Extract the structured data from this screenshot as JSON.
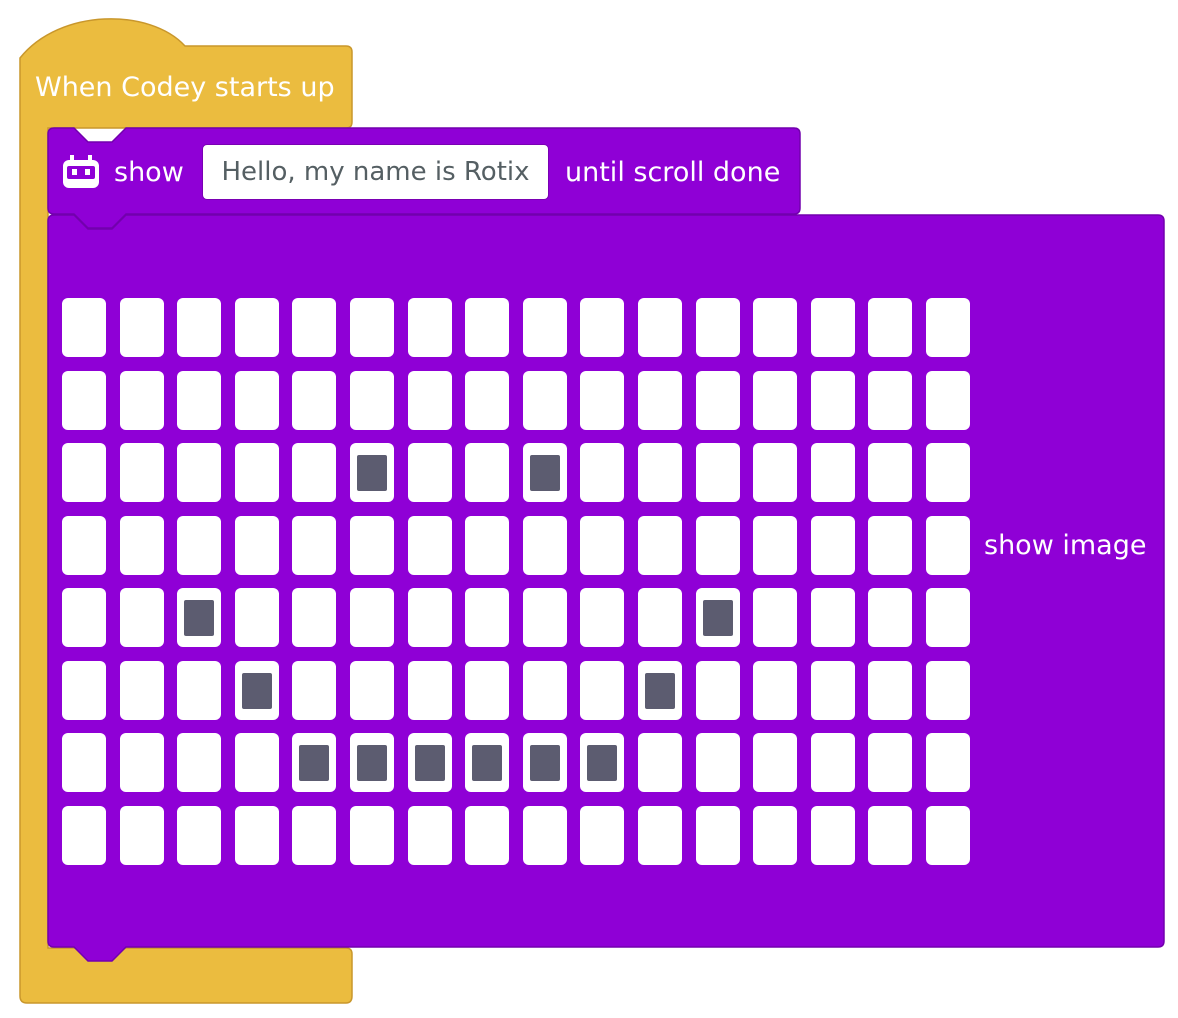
{
  "colors": {
    "hat_block": "#ebbc3f",
    "hat_outline": "#c9972c",
    "looks_block": "#8f00d6",
    "looks_outline": "#7200ad",
    "led_off": "#ffffff",
    "led_on": "#5c5c70"
  },
  "hat_block": {
    "label": "When Codey starts up"
  },
  "show_text_block": {
    "icon": "codey-robot-icon",
    "prefix_label": "show",
    "text_value": "Hello, my name is Rotix",
    "suffix_label": "until scroll done"
  },
  "show_image_block": {
    "label": "show image",
    "matrix": {
      "columns": 16,
      "rows": 8,
      "lit_pixels": [
        [
          2,
          5
        ],
        [
          2,
          8
        ],
        [
          4,
          2
        ],
        [
          4,
          11
        ],
        [
          5,
          3
        ],
        [
          5,
          10
        ],
        [
          6,
          4
        ],
        [
          6,
          5
        ],
        [
          6,
          6
        ],
        [
          6,
          7
        ],
        [
          6,
          8
        ],
        [
          6,
          9
        ]
      ]
    }
  }
}
